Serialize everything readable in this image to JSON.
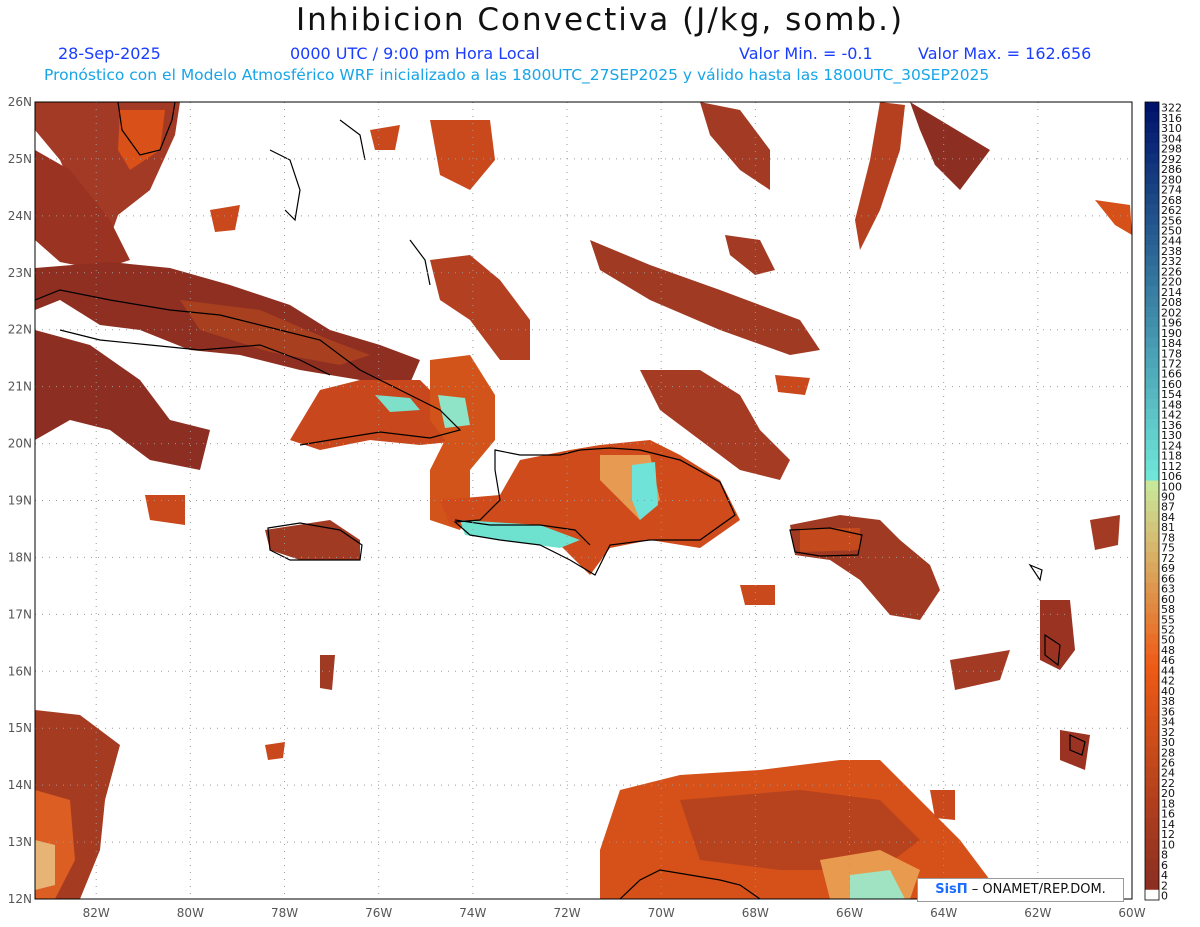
{
  "title": "Inhibicion Convectiva (J/kg, somb.)",
  "header": {
    "date": "28-Sep-2025",
    "time": "0000 UTC / 9:00 pm Hora Local",
    "valmin_label": "Valor Min. = -0.1",
    "valmax_label": "Valor Max. = 162.656",
    "model_line": "Pronóstico con el Modelo Atmosférico WRF inicializado a las 1800UTC_27SEP2025 y válido hasta las  1800UTC_30SEP2025"
  },
  "credit": {
    "brand": "SisΠ",
    "text": " – ONAMET/REP.DOM."
  },
  "map": {
    "lon_ticks": [
      "82W",
      "80W",
      "78W",
      "76W",
      "74W",
      "72W",
      "70W",
      "68W",
      "66W",
      "64W",
      "62W",
      "60W"
    ],
    "lat_ticks": [
      "26N",
      "25N",
      "24N",
      "23N",
      "22N",
      "21N",
      "20N",
      "19N",
      "18N",
      "17N",
      "16N",
      "15N",
      "14N",
      "13N",
      "12N"
    ],
    "lon_range": [
      -83.3,
      -60.0
    ],
    "lat_range": [
      12.0,
      26.0
    ]
  },
  "colorbar": {
    "labels": [
      "322",
      "316",
      "310",
      "304",
      "298",
      "292",
      "286",
      "280",
      "274",
      "268",
      "262",
      "256",
      "250",
      "244",
      "238",
      "232",
      "226",
      "220",
      "214",
      "208",
      "202",
      "196",
      "190",
      "184",
      "178",
      "172",
      "166",
      "160",
      "154",
      "148",
      "142",
      "136",
      "130",
      "124",
      "118",
      "112",
      "106",
      "100",
      "90",
      "87",
      "84",
      "81",
      "78",
      "75",
      "72",
      "69",
      "66",
      "63",
      "60",
      "58",
      "55",
      "52",
      "50",
      "48",
      "46",
      "44",
      "42",
      "40",
      "38",
      "36",
      "34",
      "32",
      "30",
      "28",
      "26",
      "24",
      "22",
      "20",
      "18",
      "16",
      "14",
      "12",
      "10",
      "8",
      "6",
      "4",
      "2",
      "0"
    ]
  },
  "colors": {
    "high": "#00136b",
    "cyan": "#6fe6d8",
    "lightgreen": "#c9e79a",
    "orange": "#ee5b16",
    "brown": "#8c2f22",
    "zero": "#ffffff"
  }
}
